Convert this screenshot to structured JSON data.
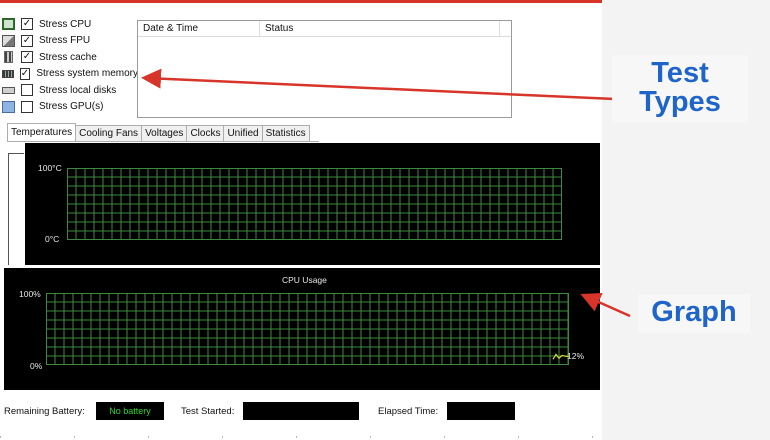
{
  "stress_options": [
    {
      "label": "Stress CPU",
      "checked": true,
      "icon": "cpu-icon"
    },
    {
      "label": "Stress FPU",
      "checked": true,
      "icon": "fpu-icon"
    },
    {
      "label": "Stress cache",
      "checked": true,
      "icon": "cache-icon"
    },
    {
      "label": "Stress system memory",
      "checked": true,
      "icon": "memory-icon"
    },
    {
      "label": "Stress local disks",
      "checked": false,
      "icon": "disk-icon"
    },
    {
      "label": "Stress GPU(s)",
      "checked": false,
      "icon": "gpu-icon"
    }
  ],
  "log_table": {
    "columns": [
      "Date & Time",
      "Status"
    ]
  },
  "tabs": [
    {
      "label": "Temperatures",
      "active": true
    },
    {
      "label": "Cooling Fans",
      "active": false
    },
    {
      "label": "Voltages",
      "active": false
    },
    {
      "label": "Clocks",
      "active": false
    },
    {
      "label": "Unified",
      "active": false
    },
    {
      "label": "Statistics",
      "active": false
    }
  ],
  "temperature_graph": {
    "max_label": "100°C",
    "min_label": "0°C"
  },
  "cpu_graph": {
    "title": "CPU Usage",
    "max_label": "100%",
    "min_label": "0%",
    "current_value_label": "12%",
    "current_value": 12
  },
  "status_bar": {
    "battery_label": "Remaining Battery:",
    "battery_value": "No battery",
    "test_started_label": "Test Started:",
    "test_started_value": "",
    "elapsed_label": "Elapsed Time:",
    "elapsed_value": ""
  },
  "annotations": {
    "test_types": [
      "Test",
      "Types"
    ],
    "graph": "Graph"
  },
  "colors": {
    "accent_red": "#d8352a",
    "annotation_blue": "#1f64c8",
    "grid_green": "#3c8a3c",
    "battery_green": "#2ed62e",
    "cpu_line_yellow": "#d9d92a"
  }
}
